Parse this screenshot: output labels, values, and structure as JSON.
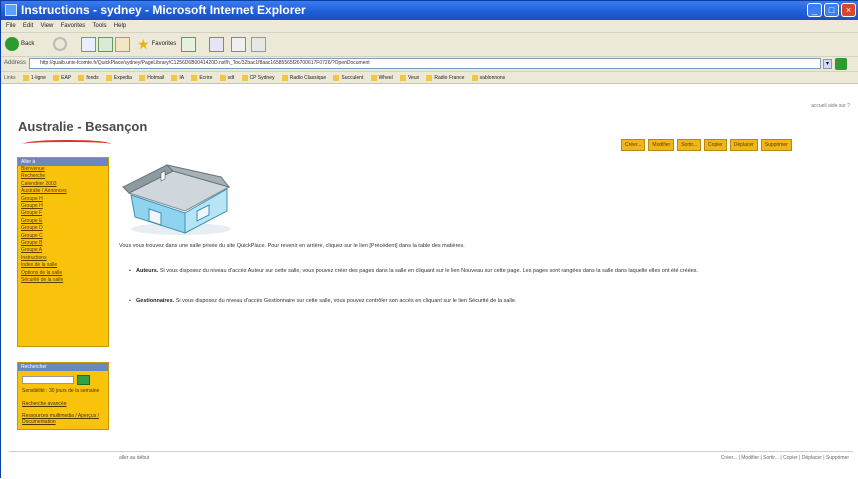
{
  "window": {
    "title": "Instructions - sydney - Microsoft Internet Explorer",
    "buttons": [
      "_",
      "□",
      "×"
    ]
  },
  "menu": [
    "File",
    "Edit",
    "View",
    "Favorites",
    "Tools",
    "Help"
  ],
  "toolbar": {
    "back_label": "Back",
    "favorites_label": "Favorites"
  },
  "address": {
    "label": "Address",
    "url": "http://quaib.univ-fcomte.fr/QuickPlace/sydney/PageLibrary/C1256D6B0041420D.nsf/h_Toc/32bac1f8aac16585565f26700617F0726/?OpenDocument"
  },
  "links": {
    "label": "Links",
    "items": [
      "1-ligne",
      "EAP",
      "fonds",
      "Expedia",
      "Hotmail",
      "IA",
      "Ecrire",
      "sdt",
      "CP Sydney",
      "Radio Classique",
      "Succulent",
      "Wheel",
      "Veux",
      "Radio France",
      "sablonnons"
    ]
  },
  "page": {
    "accueil": "accueil aide sur ?",
    "site_title": "Australie - Besançon",
    "actions": [
      "Créer...",
      "Modifier",
      "Sortir...",
      "Copier",
      "Déplacer",
      "Supprimer"
    ],
    "sidebar": {
      "heading": "Aller à",
      "items": [
        "Bienvenue",
        "Recherche",
        "Calendrier 2003",
        "Australie / Annonces",
        "Groupe H",
        "Groupe H",
        "Groupe F",
        "Groupe E",
        "Groupe D",
        "Groupe C",
        "Groupe B",
        "Groupe A",
        "Instructions",
        "Index de la salle",
        "Options de la salle",
        "Sécurité de la salle"
      ]
    },
    "search": {
      "heading": "Rechercher",
      "hint": "Sensibilité : 30 jours de la semaine",
      "advanced": "Recherche avancée",
      "links_text": "Ressources multimedia / Aperçus / Documentation"
    },
    "intro": "Vous vous trouvez dans une salle privée du site QuickPlace. Pour revenir en arrière, cliquez sur le lien [Précédent] dans la table des matières.",
    "bullets": [
      {
        "title": "Auteurs.",
        "text": "Si vous disposez du niveau d'accès Auteur sur cette salle, vous pouvez créer des pages dans la salle en cliquant sur le lien Nouveau sur cette page. Les pages sont rangées dans la salle dans laquelle elles ont été créées."
      },
      {
        "title": "Gestionnaires.",
        "text": "Si vous disposez du niveau d'accès Gestionnaire sur cette salle, vous pouvez contrôler son accès en cliquant sur le lien Sécurité de la salle."
      }
    ],
    "footer_left": "aller au début",
    "footer_right": "Créer... | Modifier | Sortir... | Copier | Déplacer | Supprimer"
  }
}
